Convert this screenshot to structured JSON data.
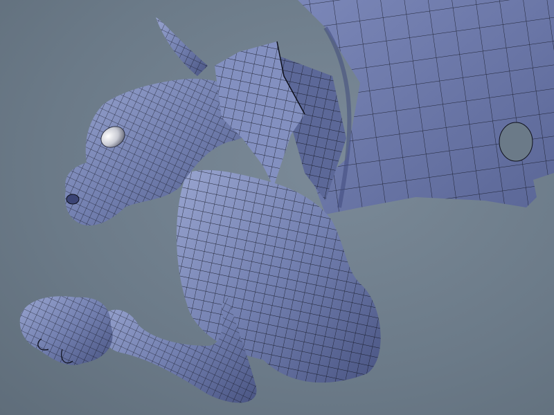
{
  "scene": {
    "subject": "dragon-wireframe-model",
    "colors": {
      "background": "#6b7a88",
      "mesh_fill_light": "#8d9ac4",
      "mesh_fill_mid": "#6f7cab",
      "mesh_fill_dark": "#4a5583",
      "wire": "#0d0f1a",
      "eye": "#e4e6ee"
    }
  }
}
